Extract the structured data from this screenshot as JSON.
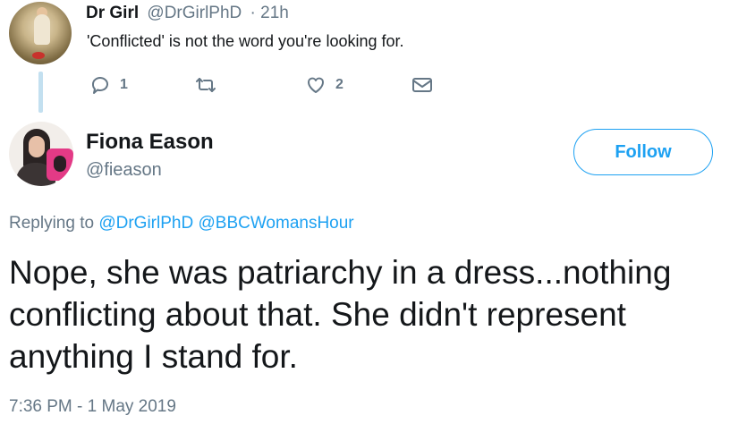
{
  "parent_tweet": {
    "display_name": "Dr Girl",
    "handle": "@DrGirlPhD",
    "time": "· 21h",
    "text": "'Conflicted' is not the word you're looking for.",
    "actions": {
      "reply_icon": "reply-icon",
      "reply_count": "1",
      "retweet_icon": "retweet-icon",
      "retweet_count": "",
      "like_icon": "heart-icon",
      "like_count": "2",
      "dm_icon": "envelope-icon"
    }
  },
  "main_tweet": {
    "display_name": "Fiona Eason",
    "handle": "@fieason",
    "follow_label": "Follow",
    "replying_prefix": "Replying to",
    "replying_to": [
      "@DrGirlPhD",
      "@BBCWomansHour"
    ],
    "text_lines": [
      "Nope, she was patriarchy in a dress...nothing",
      "conflicting about that. She didn't represent",
      "anything I stand for."
    ],
    "timestamp": "7:36 PM - 1 May 2019"
  },
  "colors": {
    "accent": "#1da1f2",
    "muted": "#657786",
    "text": "#14171a",
    "thread_line": "#c3e0f0"
  }
}
